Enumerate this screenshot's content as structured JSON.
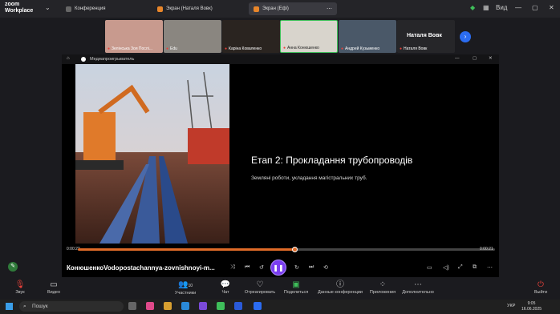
{
  "zoom": {
    "logo_line1": "zoom",
    "logo_line2": "Workplace",
    "tabs": [
      {
        "label": "Конференция",
        "icon": "home-icon"
      },
      {
        "label": "Экран (Наталя Вовк)",
        "icon": "share-screen-icon"
      },
      {
        "label": "Экран (Ефі)",
        "icon": "share-screen-icon"
      }
    ],
    "view_label": "Вид",
    "participants": [
      {
        "name": "Зелінська Зоя Послі..."
      },
      {
        "name": "Edu"
      },
      {
        "name": "Каріна Коваленко"
      },
      {
        "name": "Анна Конюшенко"
      },
      {
        "name": "Андрей Кузьменко"
      },
      {
        "name": "Наталя Вовк"
      }
    ],
    "featured_name": "Наталя Вовк",
    "toolbar": [
      {
        "label": "Звук",
        "icon": "mic-muted-icon"
      },
      {
        "label": "Видео",
        "icon": "video-icon"
      },
      {
        "label": "Участники",
        "icon": "participants-icon",
        "count": "10"
      },
      {
        "label": "Чат",
        "icon": "chat-icon"
      },
      {
        "label": "Отреагировать",
        "icon": "react-icon"
      },
      {
        "label": "Поделиться",
        "icon": "share-icon"
      },
      {
        "label": "Данные конференции",
        "icon": "info-icon"
      },
      {
        "label": "Приложения",
        "icon": "apps-icon"
      },
      {
        "label": "Дополнительно",
        "icon": "more-icon"
      },
      {
        "label": "Выйти",
        "icon": "leave-icon"
      }
    ]
  },
  "player": {
    "window_title": "Медиапроигрыватель",
    "slide_title": "Етап 2: Прокладання трубопроводів",
    "slide_subtitle": "Земляні роботи, укладання магістральних труб.",
    "time_current": "0:00:22",
    "time_total": "0:00:21",
    "progress_fraction": 0.52,
    "file_name": "КонюшенкоVodopostachannya-zovnishnoyi-m...",
    "accent_color": "#7a3ef0",
    "progress_color": "#e06b28"
  },
  "taskbar": {
    "search_placeholder": "Пошук",
    "lang": "УКР",
    "time": "9:05",
    "date": "16.06.2025"
  }
}
